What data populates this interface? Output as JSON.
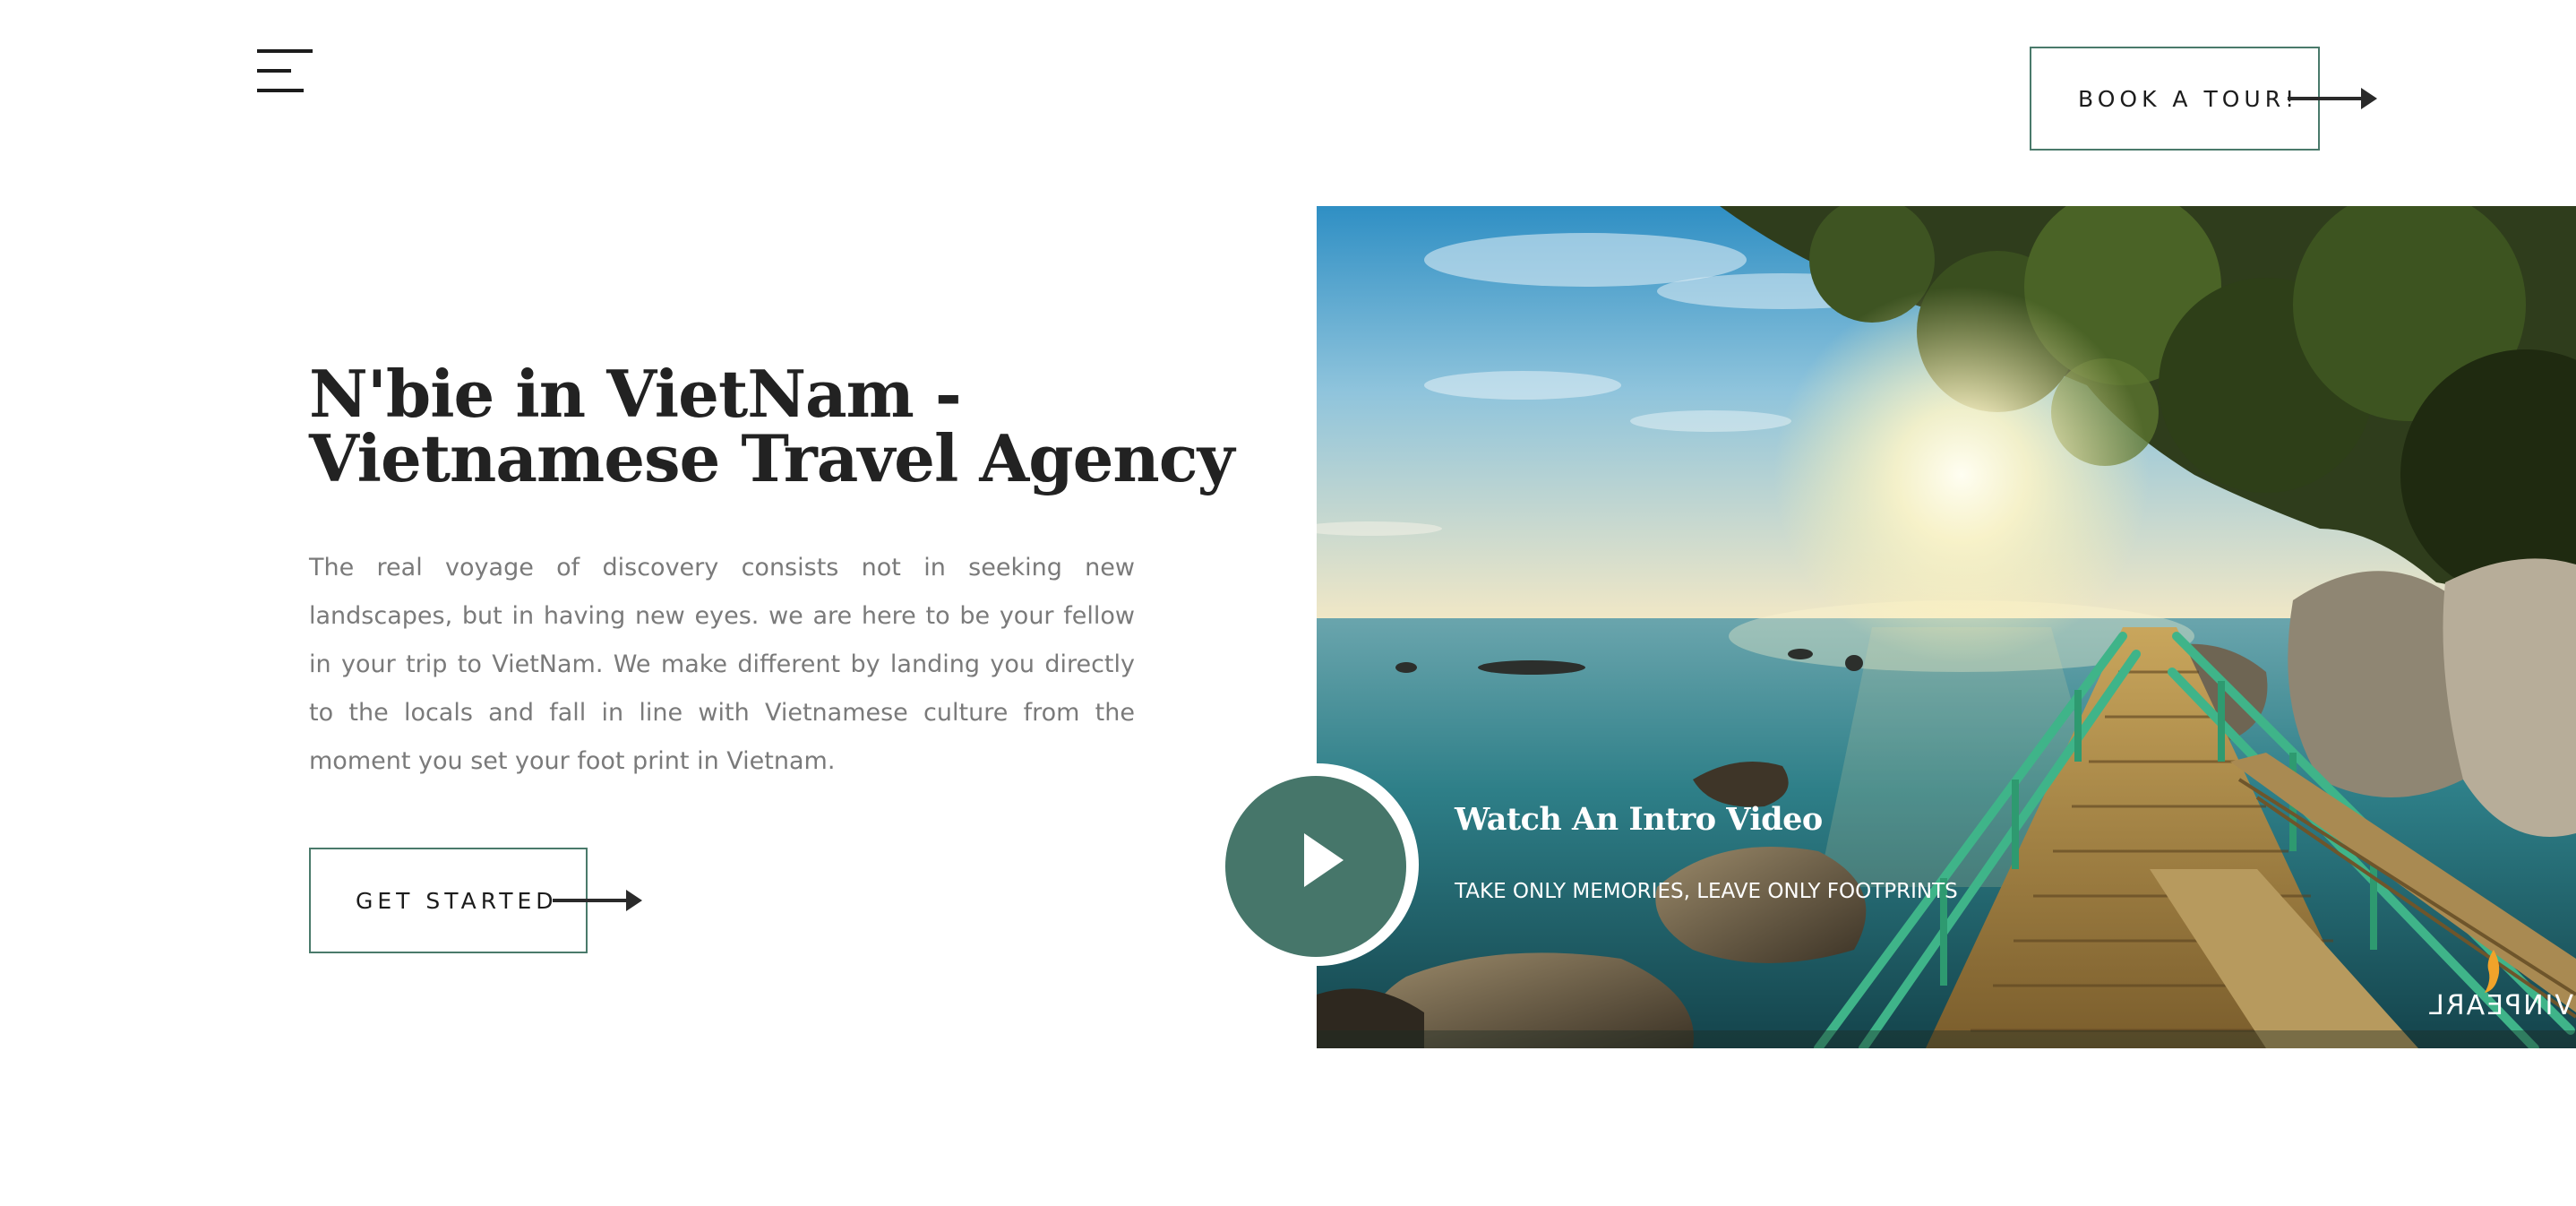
{
  "header": {
    "menu_icon": "hamburger-menu-icon",
    "book_button": "BOOK A TOUR!",
    "arrow_icon": "arrow-right-icon"
  },
  "hero": {
    "title_line1": "N'bie in VietNam -",
    "title_line2": "Vietnamese Travel Agency",
    "description": "The real voyage of discovery consists not in seeking new landscapes, but in having new eyes. we are here to be your fellow in your trip to VietNam. We make different by landing you directly to the locals and fall in line with Vietnamese culture from the moment you set your foot print in Vietnam.",
    "cta_button": "GET STARTED"
  },
  "video": {
    "title": "Watch An Intro Video",
    "subtitle": "TAKE ONLY MEMORIES, LEAVE ONLY FOOTPRINTS",
    "play_icon": "play-icon"
  },
  "photo": {
    "watermark": "VINPEARL"
  },
  "colors": {
    "accent": "#46766a",
    "heading": "#222222",
    "body_text": "#7a7a7a"
  }
}
